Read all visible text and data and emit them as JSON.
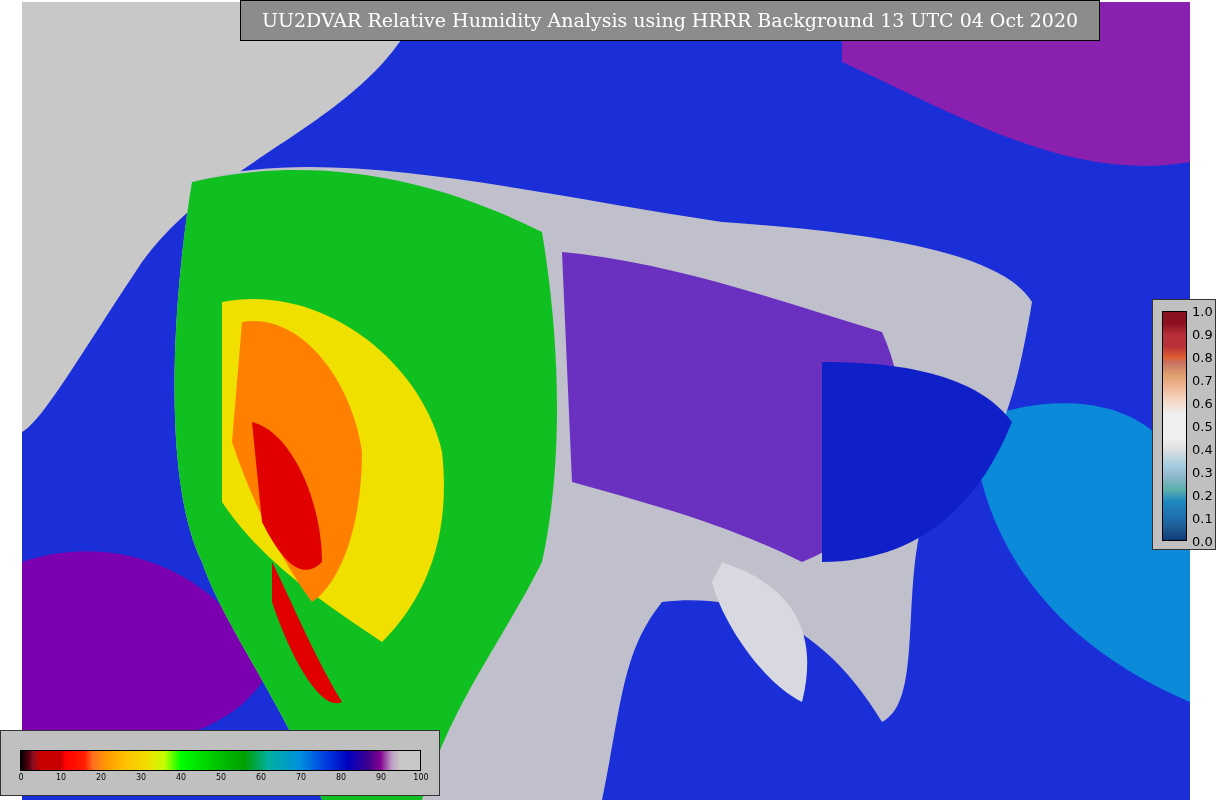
{
  "title": "UU2DVAR Relative Humidity Analysis using HRRR Background 13 UTC 04 Oct 2020",
  "colorbars": [
    {
      "kind": "horizontal",
      "ticks": [
        "0",
        "10",
        "20",
        "30",
        "40",
        "50",
        "60",
        "70",
        "80",
        "90",
        "100"
      ]
    },
    {
      "kind": "vertical",
      "ticks": [
        "1.0",
        "0.9",
        "0.8",
        "0.7",
        "0.6",
        "0.5",
        "0.4",
        "0.3",
        "0.2",
        "0.1",
        "0.0"
      ]
    }
  ]
}
